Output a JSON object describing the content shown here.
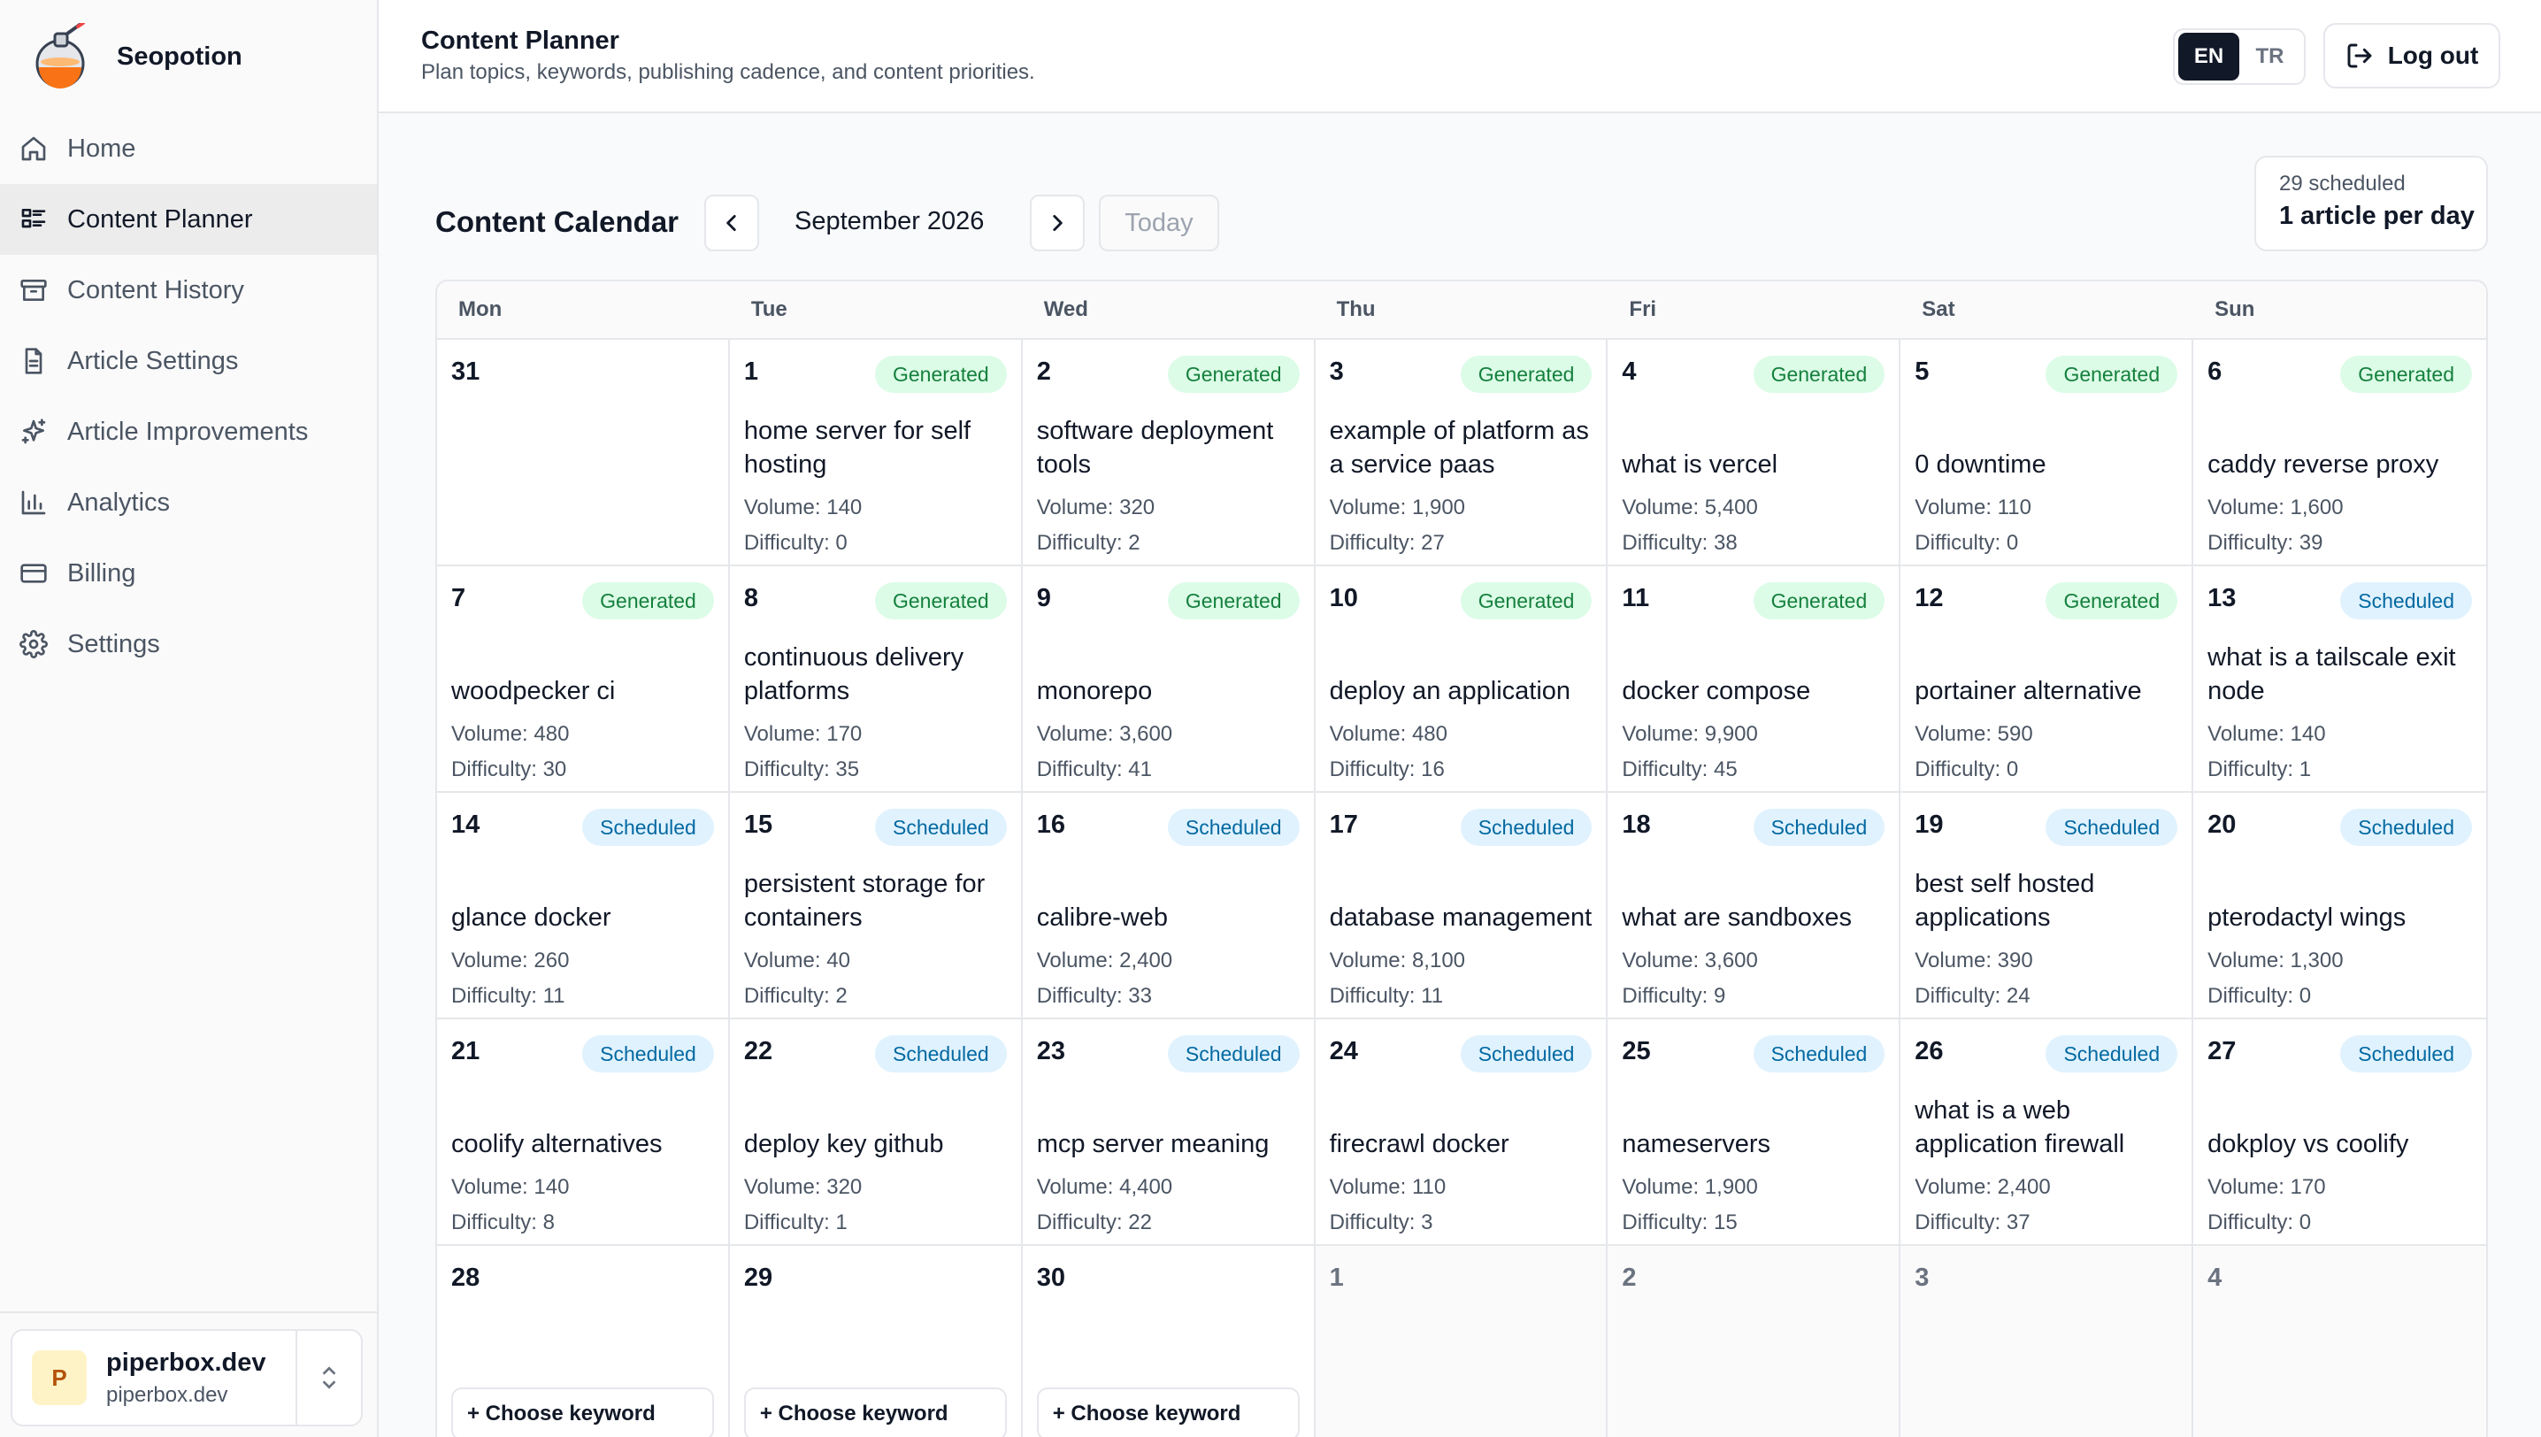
{
  "app": {
    "name": "Seopotion"
  },
  "sidebar": {
    "items": [
      {
        "label": "Home",
        "icon": "home-icon",
        "active": false
      },
      {
        "label": "Content Planner",
        "icon": "layout-list-icon",
        "active": true
      },
      {
        "label": "Content History",
        "icon": "archive-icon",
        "active": false
      },
      {
        "label": "Article Settings",
        "icon": "file-text-icon",
        "active": false
      },
      {
        "label": "Article Improvements",
        "icon": "sparkles-icon",
        "active": false
      },
      {
        "label": "Analytics",
        "icon": "bar-chart-icon",
        "active": false
      },
      {
        "label": "Billing",
        "icon": "credit-card-icon",
        "active": false
      },
      {
        "label": "Settings",
        "icon": "gear-icon",
        "active": false
      }
    ],
    "account": {
      "initial": "P",
      "name": "piperbox.dev",
      "domain": "piperbox.dev"
    }
  },
  "header": {
    "title": "Content Planner",
    "subtitle": "Plan topics, keywords, publishing cadence, and content priorities.",
    "lang": {
      "en": "EN",
      "tr": "TR",
      "active": "EN"
    },
    "logout": "Log out"
  },
  "calendar": {
    "title": "Content Calendar",
    "month": "September 2026",
    "today": "Today",
    "summary": {
      "count": "29 scheduled",
      "rate": "1 article per day"
    },
    "weekdays": [
      "Mon",
      "Tue",
      "Wed",
      "Thu",
      "Fri",
      "Sat",
      "Sun"
    ],
    "days": [
      {
        "num": "31",
        "muted": false
      },
      {
        "num": "1",
        "status": "Generated",
        "keyword": "home server for self hosting",
        "volume": "Volume: 140",
        "difficulty": "Difficulty: 0"
      },
      {
        "num": "2",
        "status": "Generated",
        "keyword": "software deployment tools",
        "volume": "Volume: 320",
        "difficulty": "Difficulty: 2"
      },
      {
        "num": "3",
        "status": "Generated",
        "keyword": "example of platform as a service paas",
        "volume": "Volume: 1,900",
        "difficulty": "Difficulty: 27"
      },
      {
        "num": "4",
        "status": "Generated",
        "keyword": "what is vercel",
        "volume": "Volume: 5,400",
        "difficulty": "Difficulty: 38"
      },
      {
        "num": "5",
        "status": "Generated",
        "keyword": "0 downtime",
        "volume": "Volume: 110",
        "difficulty": "Difficulty: 0"
      },
      {
        "num": "6",
        "status": "Generated",
        "keyword": "caddy reverse proxy",
        "volume": "Volume: 1,600",
        "difficulty": "Difficulty: 39"
      },
      {
        "num": "7",
        "status": "Generated",
        "keyword": "woodpecker ci",
        "volume": "Volume: 480",
        "difficulty": "Difficulty: 30"
      },
      {
        "num": "8",
        "status": "Generated",
        "keyword": "continuous delivery platforms",
        "volume": "Volume: 170",
        "difficulty": "Difficulty: 35"
      },
      {
        "num": "9",
        "status": "Generated",
        "keyword": "monorepo",
        "volume": "Volume: 3,600",
        "difficulty": "Difficulty: 41"
      },
      {
        "num": "10",
        "status": "Generated",
        "keyword": "deploy an application",
        "volume": "Volume: 480",
        "difficulty": "Difficulty: 16"
      },
      {
        "num": "11",
        "status": "Generated",
        "keyword": "docker compose",
        "volume": "Volume: 9,900",
        "difficulty": "Difficulty: 45"
      },
      {
        "num": "12",
        "status": "Generated",
        "keyword": "portainer alternative",
        "volume": "Volume: 590",
        "difficulty": "Difficulty: 0"
      },
      {
        "num": "13",
        "status": "Scheduled",
        "keyword": "what is a tailscale exit node",
        "volume": "Volume: 140",
        "difficulty": "Difficulty: 1"
      },
      {
        "num": "14",
        "status": "Scheduled",
        "keyword": "glance docker",
        "volume": "Volume: 260",
        "difficulty": "Difficulty: 11"
      },
      {
        "num": "15",
        "status": "Scheduled",
        "keyword": "persistent storage for containers",
        "volume": "Volume: 40",
        "difficulty": "Difficulty: 2"
      },
      {
        "num": "16",
        "status": "Scheduled",
        "keyword": "calibre-web",
        "volume": "Volume: 2,400",
        "difficulty": "Difficulty: 33"
      },
      {
        "num": "17",
        "status": "Scheduled",
        "keyword": "database management",
        "volume": "Volume: 8,100",
        "difficulty": "Difficulty: 11"
      },
      {
        "num": "18",
        "status": "Scheduled",
        "keyword": "what are sandboxes",
        "volume": "Volume: 3,600",
        "difficulty": "Difficulty: 9"
      },
      {
        "num": "19",
        "status": "Scheduled",
        "keyword": "best self hosted applications",
        "volume": "Volume: 390",
        "difficulty": "Difficulty: 24"
      },
      {
        "num": "20",
        "status": "Scheduled",
        "keyword": "pterodactyl wings",
        "volume": "Volume: 1,300",
        "difficulty": "Difficulty: 0"
      },
      {
        "num": "21",
        "status": "Scheduled",
        "keyword": "coolify alternatives",
        "volume": "Volume: 140",
        "difficulty": "Difficulty: 8"
      },
      {
        "num": "22",
        "status": "Scheduled",
        "keyword": "deploy key github",
        "volume": "Volume: 320",
        "difficulty": "Difficulty: 1"
      },
      {
        "num": "23",
        "status": "Scheduled",
        "keyword": "mcp server meaning",
        "volume": "Volume: 4,400",
        "difficulty": "Difficulty: 22"
      },
      {
        "num": "24",
        "status": "Scheduled",
        "keyword": "firecrawl docker",
        "volume": "Volume: 110",
        "difficulty": "Difficulty: 3"
      },
      {
        "num": "25",
        "status": "Scheduled",
        "keyword": "nameservers",
        "volume": "Volume: 1,900",
        "difficulty": "Difficulty: 15"
      },
      {
        "num": "26",
        "status": "Scheduled",
        "keyword": "what is a web application firewall",
        "volume": "Volume: 2,400",
        "difficulty": "Difficulty: 37"
      },
      {
        "num": "27",
        "status": "Scheduled",
        "keyword": "dokploy vs coolify",
        "volume": "Volume: 170",
        "difficulty": "Difficulty: 0"
      },
      {
        "num": "28",
        "choose": "+ Choose keyword"
      },
      {
        "num": "29",
        "choose": "+ Choose keyword"
      },
      {
        "num": "30",
        "choose": "+ Choose keyword"
      },
      {
        "num": "1",
        "muted": true
      },
      {
        "num": "2",
        "muted": true
      },
      {
        "num": "3",
        "muted": true
      },
      {
        "num": "4",
        "muted": true
      }
    ]
  },
  "colors": {
    "generated_bg": "#dcfce7",
    "generated_text": "#15803d",
    "scheduled_bg": "#e0f2fe",
    "scheduled_text": "#0369a1",
    "lang_active": "#111827"
  }
}
